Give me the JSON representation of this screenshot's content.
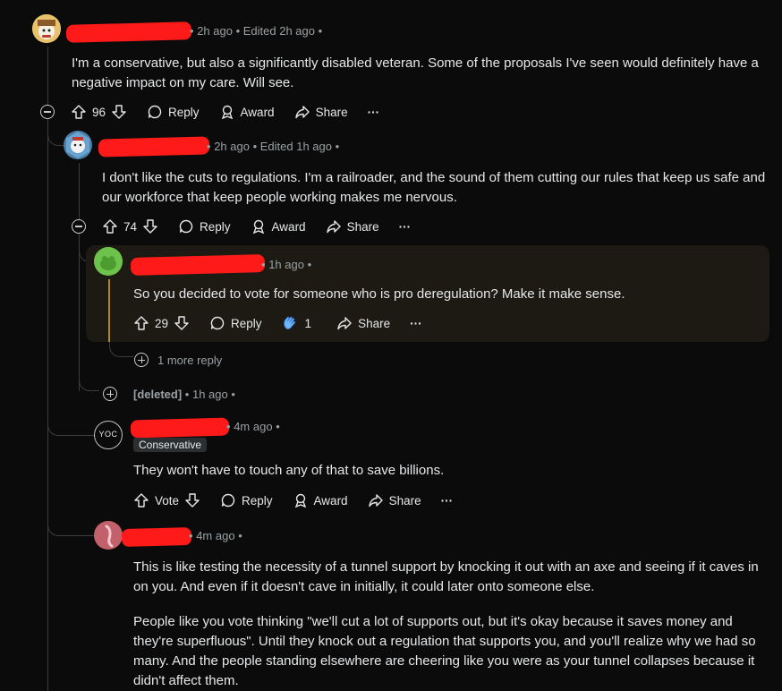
{
  "comments": [
    {
      "id": "c1",
      "username": "",
      "time": "2h ago",
      "edited": "Edited 2h ago",
      "body": "I'm a conservative, but also a significantly disabled veteran. Some of the proposals I've seen would definitely have a negative impact on my care. Will see.",
      "score": "96",
      "actions": {
        "reply": "Reply",
        "award": "Award",
        "share": "Share",
        "more": "···"
      }
    },
    {
      "id": "c2",
      "username": "",
      "time": "2h ago",
      "edited": "Edited 1h ago",
      "body": "I don't like the cuts to regulations. I'm a railroader, and the sound of them cutting our rules that keep us safe and our workforce that keep people working makes me nervous.",
      "score": "74",
      "actions": {
        "reply": "Reply",
        "award": "Award",
        "share": "Share",
        "more": "···"
      }
    },
    {
      "id": "c3",
      "username": "",
      "time": "1h ago",
      "body": "So you decided to vote for someone who is pro deregulation? Make it make sense.",
      "score": "29",
      "award_count": "1",
      "actions": {
        "reply": "Reply",
        "share": "Share",
        "more": "···"
      },
      "more_replies": "1 more reply"
    },
    {
      "id": "c4",
      "username": "[deleted]",
      "time": "1h ago"
    },
    {
      "id": "c5",
      "username": "",
      "time": "4m ago",
      "avatar_text": "YOC",
      "flair": "Conservative",
      "body": "They won't have to touch any of that to save billions.",
      "score": "Vote",
      "actions": {
        "reply": "Reply",
        "award": "Award",
        "share": "Share",
        "more": "···"
      }
    },
    {
      "id": "c6",
      "username": "",
      "time": "4m ago",
      "body_p1": "This is like testing the necessity of a tunnel support by knocking it out with an axe and seeing if it caves in on you. And even if it doesn't cave in initially, it could later onto someone else.",
      "body_p2": "People like you vote thinking \"we'll cut a lot of supports out, but it's okay because it saves money and they're superfluous\". Until they knock out a regulation that supports you, and you'll realize why we had so many. And the people standing elsewhere are cheering like you were as your tunnel collapses because it didn't affect them."
    }
  ],
  "separator": "•",
  "colors": {
    "background": "#0b0b0b",
    "text": "#e6e8ea",
    "meta": "#9aa0a4",
    "redaction": "#ff1a1a",
    "highlight_bar": "#b08a1e"
  }
}
